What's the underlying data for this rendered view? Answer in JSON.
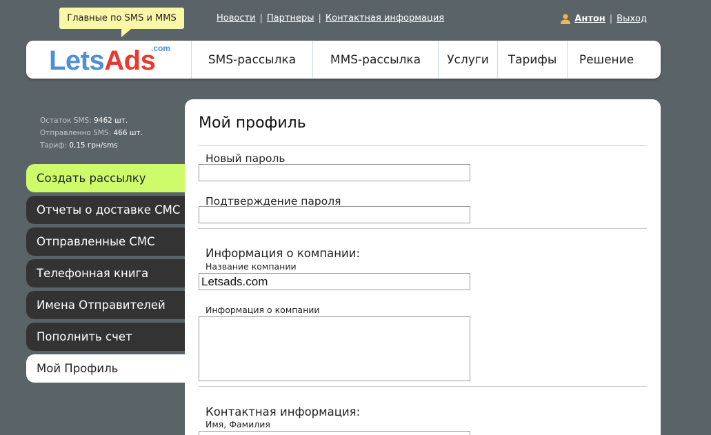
{
  "promo": {
    "text": "Главные по SMS и MMS"
  },
  "top_links": [
    "Новости",
    "Партнеры",
    "Контактная информация"
  ],
  "user": {
    "name": "Антон",
    "logout": "Выход"
  },
  "logo": {
    "part1": "Lets",
    "part2": "Ads",
    "suffix": ".com"
  },
  "nav": [
    "SMS-рассылка",
    "MMS-рассылка",
    "Услуги",
    "Тарифы",
    "Решение"
  ],
  "stats": {
    "balance_label": "Остаток SMS:",
    "balance_value": "9462 шт.",
    "sent_label": "Отправленно SMS:",
    "sent_value": "466 шт.",
    "tariff_label": "Тариф:",
    "tariff_value": "0,15 грн/sms"
  },
  "sidebar": [
    "Создать рассылку",
    "Отчеты о доставке СМС",
    "Отправленные СМС",
    "Телефонная книга",
    "Имена Отправителей",
    "Пополнить счет",
    "Мой Профиль"
  ],
  "profile": {
    "title": "Мой профиль",
    "new_password_label": "Новый пароль",
    "new_password_value": "",
    "confirm_password_label": "Подтверждение пароля",
    "confirm_password_value": "",
    "company_section": "Информация о компании:",
    "company_name_label": "Название компании",
    "company_name_value": "Letsads.com",
    "company_info_label": "Информация о компании",
    "company_info_value": "",
    "contact_section": "Контактная информация:",
    "full_name_label": "Имя, Фамилия"
  },
  "colors": {
    "background": "#5a6368",
    "accent_green": "#cdfb6a",
    "menu_dark": "#333333",
    "promo_yellow": "#fbf7a8",
    "logo_blue": "#4e8fd8",
    "logo_red": "#e8392e"
  }
}
